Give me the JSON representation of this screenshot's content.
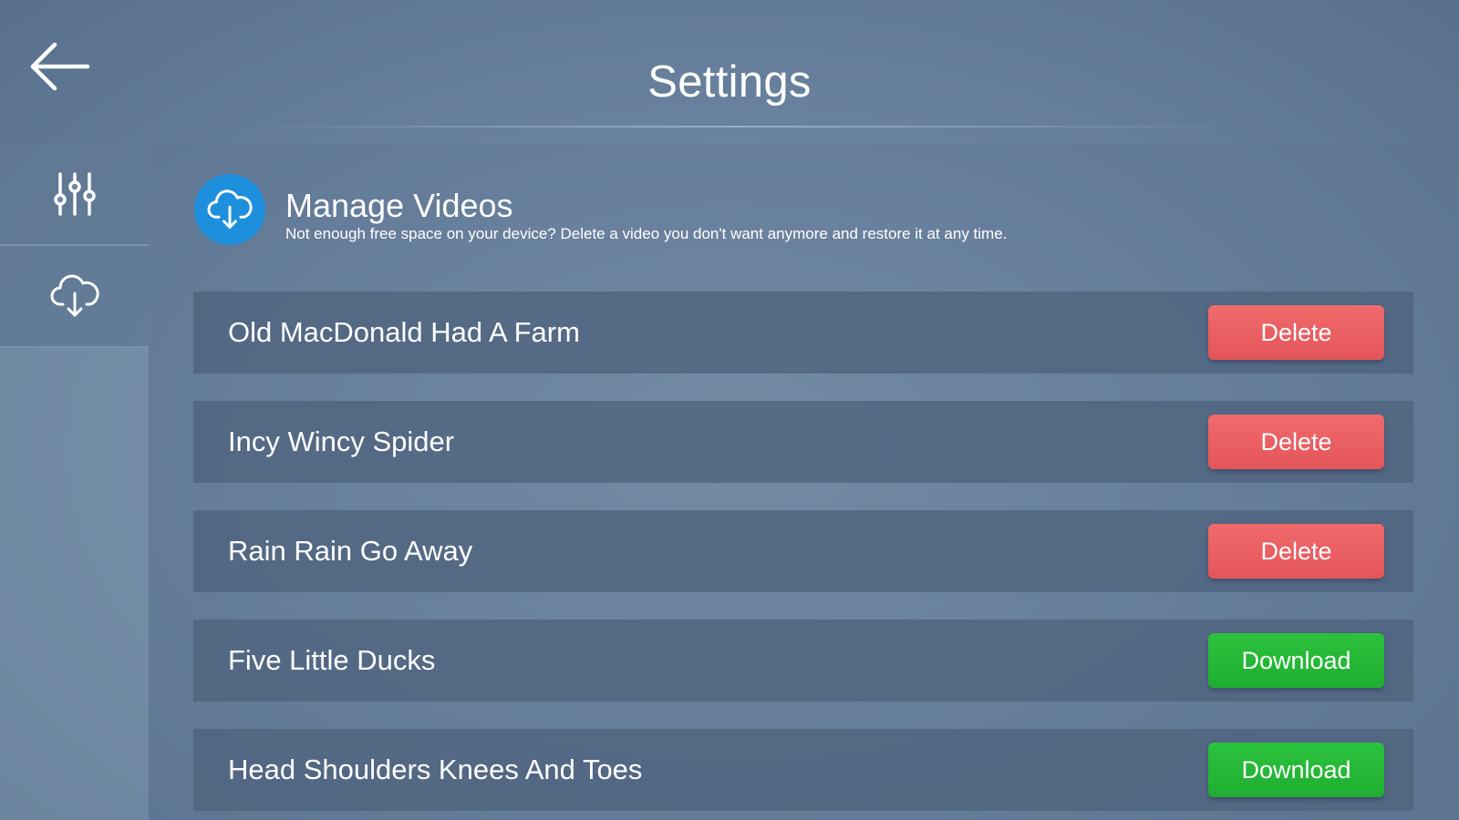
{
  "header": {
    "title": "Settings",
    "back_icon": "arrow-left-icon"
  },
  "sidebar": {
    "items": [
      {
        "icon": "sliders-icon",
        "selected": false
      },
      {
        "icon": "cloud-download-icon",
        "selected": true
      }
    ]
  },
  "section": {
    "icon": "cloud-download-icon",
    "title": "Manage Videos",
    "description": "Not enough free space on your device? Delete a video you don't want anymore and restore it at any time."
  },
  "videos": [
    {
      "name": "Old MacDonald Had A Farm",
      "action": "Delete"
    },
    {
      "name": "Incy Wincy Spider",
      "action": "Delete"
    },
    {
      "name": "Rain Rain Go Away",
      "action": "Delete"
    },
    {
      "name": "Five Little Ducks",
      "action": "Download"
    },
    {
      "name": "Head Shoulders Knees And Toes",
      "action": "Download"
    }
  ],
  "colors": {
    "delete": "#e95d60",
    "download": "#26b837",
    "accent": "#1e8fdc"
  }
}
